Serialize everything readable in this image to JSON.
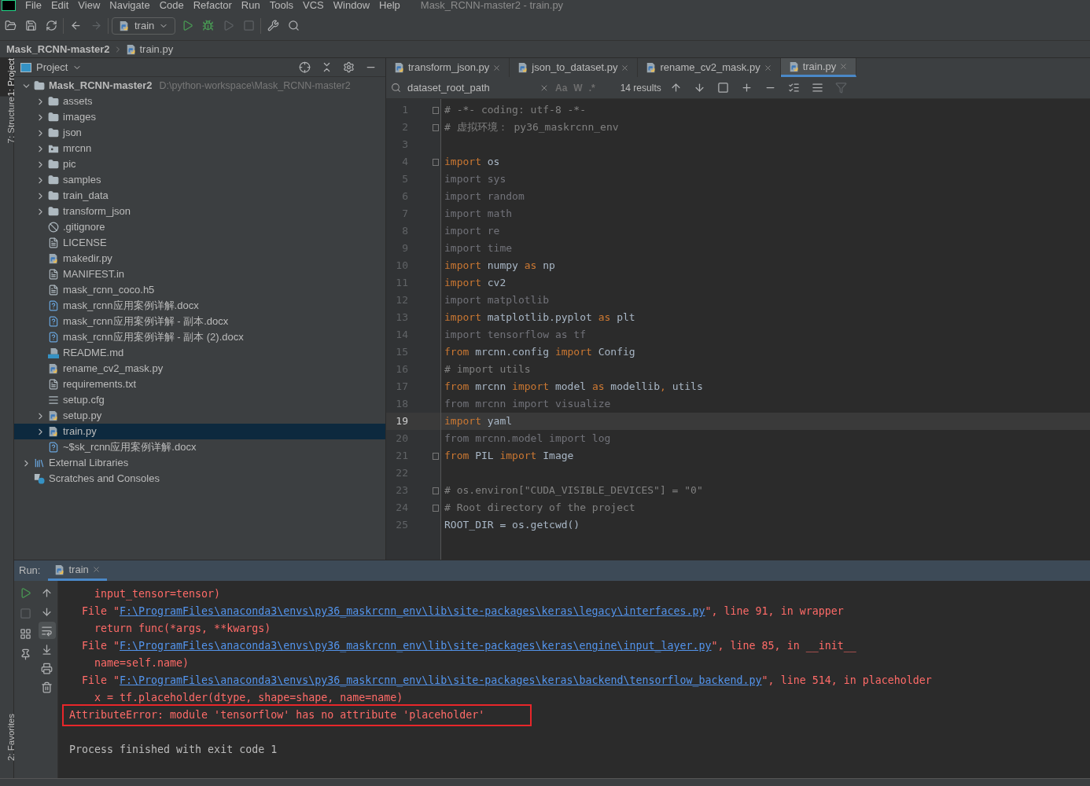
{
  "menu": [
    "File",
    "Edit",
    "View",
    "Navigate",
    "Code",
    "Refactor",
    "Run",
    "Tools",
    "VCS",
    "Window",
    "Help"
  ],
  "window_title": "Mask_RCNN-master2 - train.py",
  "run_config": "train",
  "breadcrumb": [
    "Mask_RCNN-master2",
    "train.py"
  ],
  "side_tabs": [
    {
      "label": "1: Project",
      "selected": true
    },
    {
      "label": "7: Structure",
      "selected": false
    }
  ],
  "bottom_side_tab": {
    "label": "2: Favorites"
  },
  "project_panel": {
    "title": "Project",
    "tree": [
      {
        "label": "Mask_RCNN-master2",
        "hint": "D:\\python-workspace\\Mask_RCNN-master2",
        "kind": "folder",
        "expanded": true,
        "selected": false,
        "children": [
          {
            "label": "assets",
            "kind": "folder",
            "expanded": false,
            "selected": false
          },
          {
            "label": "images",
            "kind": "folder",
            "expanded": false,
            "selected": false
          },
          {
            "label": "json",
            "kind": "folder",
            "expanded": false,
            "selected": false
          },
          {
            "label": "mrcnn",
            "kind": "package",
            "expanded": false,
            "selected": false
          },
          {
            "label": "pic",
            "kind": "folder",
            "expanded": false,
            "selected": false
          },
          {
            "label": "samples",
            "kind": "folder",
            "expanded": false,
            "selected": false
          },
          {
            "label": "train_data",
            "kind": "folder",
            "expanded": false,
            "selected": false
          },
          {
            "label": "transform_json",
            "kind": "folder",
            "expanded": false,
            "selected": false
          },
          {
            "label": ".gitignore",
            "kind": "ignore",
            "selected": false
          },
          {
            "label": "LICENSE",
            "kind": "text",
            "selected": false
          },
          {
            "label": "makedir.py",
            "kind": "py",
            "selected": false
          },
          {
            "label": "MANIFEST.in",
            "kind": "text",
            "selected": false
          },
          {
            "label": "mask_rcnn_coco.h5",
            "kind": "text",
            "selected": false
          },
          {
            "label": "mask_rcnn应用案例详解.docx",
            "kind": "unknown",
            "selected": false
          },
          {
            "label": "mask_rcnn应用案例详解 - 副本.docx",
            "kind": "unknown",
            "selected": false
          },
          {
            "label": "mask_rcnn应用案例详解 - 副本 (2).docx",
            "kind": "unknown",
            "selected": false
          },
          {
            "label": "README.md",
            "kind": "md",
            "selected": false
          },
          {
            "label": "rename_cv2_mask.py",
            "kind": "py",
            "selected": false
          },
          {
            "label": "requirements.txt",
            "kind": "text",
            "selected": false
          },
          {
            "label": "setup.cfg",
            "kind": "cfg",
            "selected": false
          },
          {
            "label": "setup.py",
            "kind": "py",
            "expanded": false,
            "selected": false
          },
          {
            "label": "train.py",
            "kind": "py",
            "expanded": false,
            "selected": true
          },
          {
            "label": "~$sk_rcnn应用案例详解.docx",
            "kind": "unknown",
            "selected": false
          }
        ]
      },
      {
        "label": "External Libraries",
        "kind": "library",
        "expanded": false,
        "selected": false
      },
      {
        "label": "Scratches and Consoles",
        "kind": "scratch",
        "selected": false
      }
    ]
  },
  "editor_tabs": [
    {
      "label": "transform_json.py",
      "selected": false
    },
    {
      "label": "json_to_dataset.py",
      "selected": false
    },
    {
      "label": "rename_cv2_mask.py",
      "selected": false
    },
    {
      "label": "train.py",
      "selected": true
    }
  ],
  "find_bar": {
    "value": "dataset_root_path",
    "results": "14 results",
    "match_case": "Aa",
    "words": "W",
    "regex": ".*"
  },
  "code_lines": [
    {
      "number": "1",
      "fold": true,
      "current": false,
      "tokens": [
        {
          "text": "# -*- coding: utf-8 -*-",
          "kind": "comment"
        }
      ]
    },
    {
      "number": "2",
      "fold": true,
      "current": false,
      "tokens": [
        {
          "text": "# 虚拟环境： py36_maskrcnn_env",
          "kind": "comment"
        }
      ]
    },
    {
      "number": "3",
      "fold": false,
      "current": false
    },
    {
      "number": "4",
      "fold": true,
      "current": false,
      "tokens": [
        {
          "text": "import",
          "kind": "kw"
        },
        {
          "text": " os",
          "kind": "plain"
        }
      ]
    },
    {
      "number": "5",
      "fold": false,
      "current": false,
      "tokens": [
        {
          "text": "import sys",
          "kind": "unused"
        }
      ]
    },
    {
      "number": "6",
      "fold": false,
      "current": false,
      "tokens": [
        {
          "text": "import random",
          "kind": "unused"
        }
      ]
    },
    {
      "number": "7",
      "fold": false,
      "current": false,
      "tokens": [
        {
          "text": "import math",
          "kind": "unused"
        }
      ]
    },
    {
      "number": "8",
      "fold": false,
      "current": false,
      "tokens": [
        {
          "text": "import re",
          "kind": "unused"
        }
      ]
    },
    {
      "number": "9",
      "fold": false,
      "current": false,
      "tokens": [
        {
          "text": "import time",
          "kind": "unused"
        }
      ]
    },
    {
      "number": "10",
      "fold": false,
      "current": false,
      "tokens": [
        {
          "text": "import",
          "kind": "kw"
        },
        {
          "text": " numpy ",
          "kind": "plain"
        },
        {
          "text": "as",
          "kind": "kw"
        },
        {
          "text": " np",
          "kind": "plain"
        }
      ]
    },
    {
      "number": "11",
      "fold": false,
      "current": false,
      "tokens": [
        {
          "text": "import",
          "kind": "kw"
        },
        {
          "text": " cv2",
          "kind": "plain"
        }
      ]
    },
    {
      "number": "12",
      "fold": false,
      "current": false,
      "tokens": [
        {
          "text": "import matplotlib",
          "kind": "unused"
        }
      ]
    },
    {
      "number": "13",
      "fold": false,
      "current": false,
      "tokens": [
        {
          "text": "import",
          "kind": "kw"
        },
        {
          "text": " matplotlib.pyplot ",
          "kind": "plain"
        },
        {
          "text": "as",
          "kind": "kw"
        },
        {
          "text": " plt",
          "kind": "plain"
        }
      ]
    },
    {
      "number": "14",
      "fold": false,
      "current": false,
      "tokens": [
        {
          "text": "import tensorflow as tf",
          "kind": "unused"
        }
      ]
    },
    {
      "number": "15",
      "fold": false,
      "current": false,
      "tokens": [
        {
          "text": "from",
          "kind": "kw"
        },
        {
          "text": " mrcnn.config ",
          "kind": "plain"
        },
        {
          "text": "import",
          "kind": "kw"
        },
        {
          "text": " Config",
          "kind": "plain"
        }
      ]
    },
    {
      "number": "16",
      "fold": false,
      "current": false,
      "tokens": [
        {
          "text": "# import utils",
          "kind": "comment"
        }
      ]
    },
    {
      "number": "17",
      "fold": false,
      "current": false,
      "tokens": [
        {
          "text": "from",
          "kind": "kw"
        },
        {
          "text": " mrcnn ",
          "kind": "plain"
        },
        {
          "text": "import",
          "kind": "kw"
        },
        {
          "text": " model ",
          "kind": "plain"
        },
        {
          "text": "as",
          "kind": "kw"
        },
        {
          "text": " modellib",
          "kind": "plain"
        },
        {
          "text": ",",
          "kind": "kw"
        },
        {
          "text": " utils",
          "kind": "plain"
        }
      ]
    },
    {
      "number": "18",
      "fold": false,
      "current": false,
      "tokens": [
        {
          "text": "from mrcnn import visualize",
          "kind": "unused"
        }
      ]
    },
    {
      "number": "19",
      "fold": false,
      "current": true,
      "tokens": [
        {
          "text": "import",
          "kind": "kw"
        },
        {
          "text": " yaml",
          "kind": "plain"
        }
      ]
    },
    {
      "number": "20",
      "fold": false,
      "current": false,
      "tokens": [
        {
          "text": "from mrcnn.model import log",
          "kind": "unused"
        }
      ]
    },
    {
      "number": "21",
      "fold": true,
      "current": false,
      "tokens": [
        {
          "text": "from",
          "kind": "kw"
        },
        {
          "text": " PIL ",
          "kind": "plain"
        },
        {
          "text": "import",
          "kind": "kw"
        },
        {
          "text": " Image",
          "kind": "plain"
        }
      ]
    },
    {
      "number": "22",
      "fold": false,
      "current": false
    },
    {
      "number": "23",
      "fold": true,
      "current": false,
      "tokens": [
        {
          "text": "# os.environ[\"CUDA_VISIBLE_DEVICES\"] = \"0\"",
          "kind": "comment"
        }
      ]
    },
    {
      "number": "24",
      "fold": true,
      "current": false,
      "tokens": [
        {
          "text": "# Root directory of the project",
          "kind": "comment"
        }
      ]
    },
    {
      "number": "25",
      "fold": false,
      "current": false,
      "tokens": [
        {
          "text": "ROOT_DIR = os.getcwd()",
          "kind": "plain"
        }
      ]
    }
  ],
  "run_panel": {
    "label": "Run:",
    "tab": "train",
    "console": [
      {
        "kind": "line",
        "segments": [
          {
            "text": "    input_tensor=tensor)",
            "kind": "error"
          }
        ]
      },
      {
        "kind": "line",
        "segments": [
          {
            "text": "  File \"",
            "kind": "error"
          },
          {
            "text": "F:\\ProgramFiles\\anaconda3\\envs\\py36_maskrcnn_env\\lib\\site-packages\\keras\\legacy\\interfaces.py",
            "kind": "link"
          },
          {
            "text": "\", line 91, in wrapper",
            "kind": "error"
          }
        ]
      },
      {
        "kind": "line",
        "segments": [
          {
            "text": "    return func(*args, **kwargs)",
            "kind": "error"
          }
        ]
      },
      {
        "kind": "line",
        "segments": [
          {
            "text": "  File \"",
            "kind": "error"
          },
          {
            "text": "F:\\ProgramFiles\\anaconda3\\envs\\py36_maskrcnn_env\\lib\\site-packages\\keras\\engine\\input_layer.py",
            "kind": "link"
          },
          {
            "text": "\", line 85, in __init__",
            "kind": "error"
          }
        ]
      },
      {
        "kind": "line",
        "segments": [
          {
            "text": "    name=self.name)",
            "kind": "error"
          }
        ]
      },
      {
        "kind": "line",
        "segments": [
          {
            "text": "  File \"",
            "kind": "error"
          },
          {
            "text": "F:\\ProgramFiles\\anaconda3\\envs\\py36_maskrcnn_env\\lib\\site-packages\\keras\\backend\\tensorflow_backend.py",
            "kind": "link"
          },
          {
            "text": "\", line 514, in placeholder",
            "kind": "error"
          }
        ]
      },
      {
        "kind": "line",
        "segments": [
          {
            "text": "    x = tf.placeholder(dtype, shape=shape, name=name)",
            "kind": "error"
          }
        ]
      },
      {
        "kind": "highlighted",
        "segments": [
          {
            "text": "AttributeError: module 'tensorflow' has no attribute 'placeholder'",
            "kind": "error"
          }
        ]
      },
      {
        "kind": "blank"
      },
      {
        "kind": "line",
        "segments": [
          {
            "text": "Process finished with exit code 1",
            "kind": "plain"
          }
        ]
      }
    ]
  }
}
